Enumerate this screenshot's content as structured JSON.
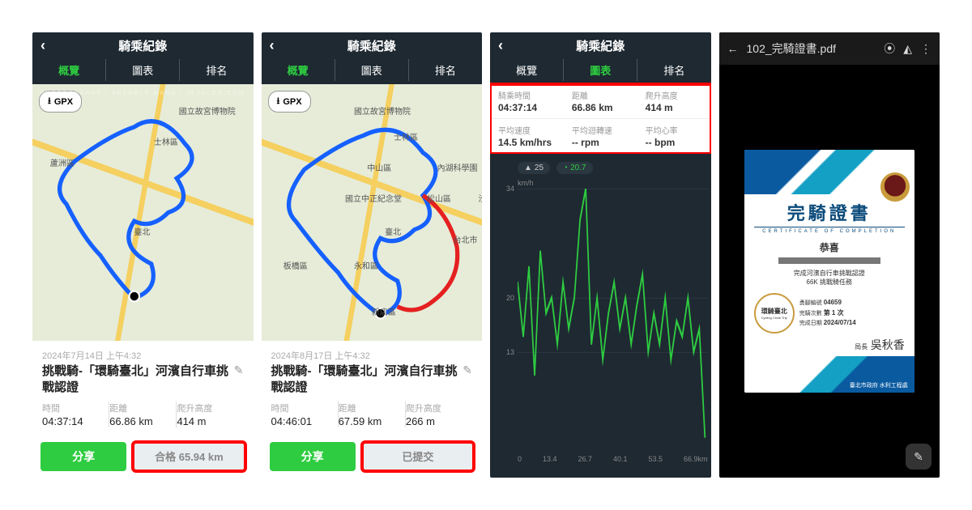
{
  "app_title": "騎乘紀錄",
  "watermark": "PHOTOGRAPHY / SHENGLE WANG / JFSBLOG.COM",
  "tabs": {
    "overview": "概覽",
    "chart": "圖表",
    "rank": "排名"
  },
  "gpx_btn": "GPX",
  "panel1": {
    "date": "2024年7月14日 上午4:32",
    "title": "挑戰騎-「環騎臺北」河濱自行車挑戰認證",
    "metrics": [
      {
        "lbl": "時間",
        "val": "04:37:14"
      },
      {
        "lbl": "距離",
        "val": "66.86 km"
      },
      {
        "lbl": "爬升高度",
        "val": "414 m"
      }
    ],
    "share": "分享",
    "status": "合格 65.94 km",
    "places": [
      "國立故宮博物院",
      "士林區",
      "蘆洲區",
      "內湖科學園",
      "中山區",
      "國立中正紀念堂",
      "松山區",
      "臺北",
      "板橋區",
      "永和區",
      "新店區",
      "台北市",
      "汐"
    ]
  },
  "panel2": {
    "date": "2024年8月17日 上午4:32",
    "title": "挑戰騎-「環騎臺北」河濱自行車挑戰認證",
    "metrics": [
      {
        "lbl": "時間",
        "val": "04:46:01"
      },
      {
        "lbl": "距離",
        "val": "67.59 km"
      },
      {
        "lbl": "爬升高度",
        "val": "266 m"
      }
    ],
    "share": "分享",
    "status": "已提交"
  },
  "panel3": {
    "stats": [
      [
        {
          "lbl": "騎乘時間",
          "val": "04:37:14"
        },
        {
          "lbl": "距離",
          "val": "66.86 km"
        },
        {
          "lbl": "爬升高度",
          "val": "414 m"
        }
      ],
      [
        {
          "lbl": "平均速度",
          "val": "14.5 km/hrs"
        },
        {
          "lbl": "平均迴轉速",
          "val": "-- rpm"
        },
        {
          "lbl": "平均心率",
          "val": "-- bpm"
        }
      ]
    ],
    "badges": {
      "elev": "25",
      "speed": "20.7"
    },
    "y_unit": "km/h"
  },
  "chart_data": {
    "type": "line",
    "title": "",
    "xlabel": "km",
    "ylabel": "km/h",
    "xlim": [
      0,
      66.9
    ],
    "ylim": [
      0,
      34
    ],
    "y_ticks": [
      13,
      20,
      34
    ],
    "x_ticks": [
      0,
      13.4,
      26.7,
      40.1,
      53.5,
      66.9
    ],
    "x_tick_labels": [
      "0",
      "13.4",
      "26.7",
      "40.1",
      "53.5",
      "66.9km"
    ],
    "x": [
      0,
      2,
      4,
      6,
      8,
      10,
      12,
      14,
      16,
      18,
      20,
      22,
      24,
      26,
      28,
      30,
      32,
      34,
      36,
      38,
      40,
      42,
      44,
      46,
      48,
      50,
      52,
      54,
      56,
      58,
      60,
      62,
      64,
      66
    ],
    "values": [
      22,
      15,
      24,
      10,
      26,
      18,
      20,
      14,
      22,
      16,
      20,
      30,
      34,
      14,
      20,
      12,
      18,
      22,
      16,
      20,
      14,
      19,
      23,
      13,
      18,
      14,
      20,
      12,
      17,
      15,
      20,
      13,
      16,
      2
    ]
  },
  "panel4": {
    "filename": "102_完騎證書.pdf",
    "cert": {
      "title": "完騎證書",
      "subtitle": "CERTIFICATE OF COMPLETION",
      "congrats": "恭喜",
      "desc1": "完成河濱自行車挑戰認證",
      "desc2": "66K 挑戰騎任務",
      "logo_text": "環騎臺北",
      "logo_sub": "Cycling Circle Trip",
      "badge_no_lbl": "勇腳編號",
      "badge_no": "04659",
      "attempt_lbl": "完騎次數",
      "attempt": "第 1 次",
      "done_lbl": "完成日期",
      "done": "2024/07/14",
      "sign_title": "局長",
      "sign_name": "吳秋香",
      "footer": "臺北市政府 水利工程處"
    }
  }
}
